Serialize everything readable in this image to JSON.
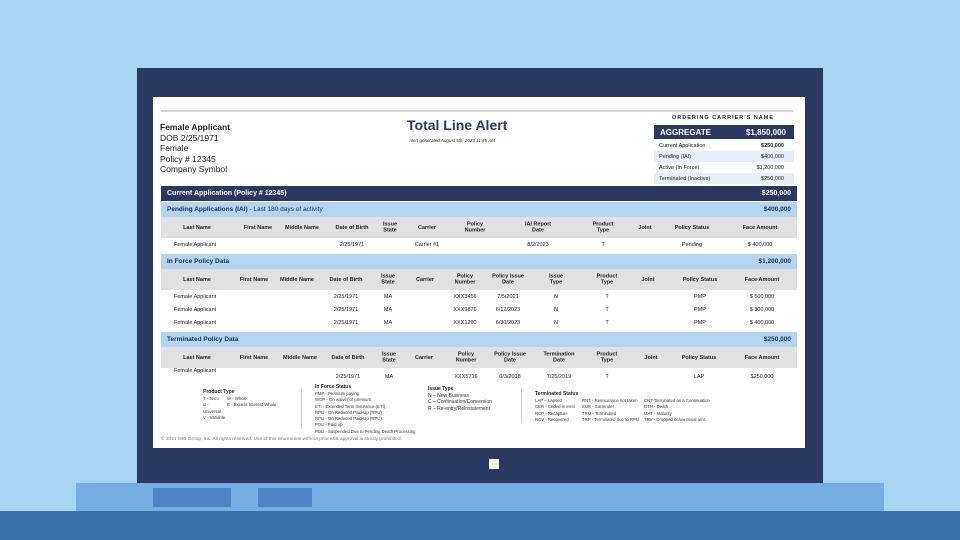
{
  "applicant": {
    "name": "Female Applicant",
    "dob": "DOB 2/25/1971",
    "gender": "Female",
    "policy": "Policy # 12345",
    "company": "Company Symbol"
  },
  "header": {
    "title": "Total Line Alert",
    "generated": "Alert generated August 5th, 2023 11:45 AM"
  },
  "carrier_box": {
    "label": "ORDERING CARRIER'S NAME",
    "aggregate_label": "AGGREGATE",
    "aggregate_value": "$1,850,000",
    "rows": [
      {
        "label": "Current Application",
        "value": "$250,000"
      },
      {
        "label": "Pending (IAI)",
        "value": "$400,000"
      },
      {
        "label": "Active (In Force)",
        "value": "$1,200,000"
      },
      {
        "label": "Terminated (Inactive)",
        "value": "$250,000"
      }
    ]
  },
  "current": {
    "label": "Current Application (Policy # 12345)",
    "value": "$250,000"
  },
  "pending": {
    "label": "Pending Applications (IAI)",
    "sublabel": " - Last 180 days of activity",
    "value": "$400,000",
    "columns": [
      "Last Name",
      "First Name",
      "Middle Name",
      "Date of Birth",
      "Issue\nState",
      "Carrier",
      "Policy\nNumber",
      "IAI Report\nDate",
      "Product\nType",
      "Joint",
      "Policy Status",
      "Face Amount"
    ],
    "rows": [
      [
        "Female Applicant",
        "",
        "",
        "2/25/1971",
        "",
        "Carrier #1",
        "",
        "8/2/2023",
        "T",
        "",
        "Pending",
        "$ 400,000"
      ]
    ]
  },
  "inforce": {
    "label": "In Force Policy Data",
    "value": "$1,200,000",
    "columns": [
      "Last Name",
      "First Name",
      "Middle Name",
      "Date of Birth",
      "Issue\nState",
      "Carrier",
      "Policy\nNumber",
      "Policy Issue\nDate",
      "Issue\nType",
      "Product\nType",
      "Joint",
      "Policy Status",
      "Face Amount"
    ],
    "rows": [
      [
        "Female Applicant",
        "",
        "",
        "2/25/1971",
        "MA",
        "",
        "XXX3456",
        "7/5/2021",
        "N",
        "T",
        "",
        "PMP",
        "$ 500,000"
      ],
      [
        "Female Applicant",
        "",
        "",
        "2/25/1971",
        "MA",
        "",
        "XXX9876",
        "6/12/2023",
        "N",
        "T",
        "",
        "PMP",
        "$ 300,000"
      ],
      [
        "Female Applicant",
        "",
        "",
        "2/25/1971",
        "MA",
        "",
        "XXX1290",
        "6/30/2023",
        "N",
        "T",
        "",
        "PMP",
        "$ 400,000"
      ]
    ]
  },
  "terminated": {
    "label": "Terminated Policy Data",
    "value": "$250,000",
    "columns": [
      "Last Name",
      "First Name",
      "Middle Name",
      "Date of Birth",
      "Issue\nState",
      "Carrier",
      "Policy\nNumber",
      "Policy Issue\nDate",
      "Termination\nDate",
      "Product\nType",
      "Joint",
      "Policy Status",
      "Face Amount"
    ],
    "rows": [
      [
        "Female Applicant",
        "",
        "",
        "2/25/1971",
        "MA",
        "",
        "XXX5716",
        "6/3/2018",
        "7/25/2019",
        "T",
        "",
        "LAP",
        "$250,000"
      ]
    ]
  },
  "legend": {
    "product_type": {
      "title": "Product Type",
      "items": [
        "T - Term",
        "W - Whole",
        "U - Universal",
        "E - Excess Interest Whole",
        "V - Variable"
      ]
    },
    "inforce_status": {
      "title": "In Force Status",
      "items": [
        "PMP - Premium paying",
        "WOP - On waiver of premium",
        "ETI - Extended Term Insurance (ETI)",
        "RPU - On Reduced Paid-Up (RPU)",
        "RPU - On Reduced Paid-Up (RPU)",
        "PDU - Paid up",
        "PDU - Suspended Due to Pending Death Processing"
      ]
    },
    "issue_type": {
      "title": "Issue Type",
      "items": [
        "N – New Business",
        "C – Continuation/Conversion",
        "R – Re-entry/Reinstatement"
      ]
    },
    "terminated_status": {
      "title": "Terminated Status",
      "items": [
        "LAP – Lapsed",
        "CER - Ceded in error",
        "RCP - Recapture",
        "RCV - Recovered",
        "RNT - Reinsurance not taken",
        "SUR - Surrender",
        "TRM - Terminated",
        "TRP - Terminated due to RPU",
        "CNT-Terminated as a Continuation",
        "DTH - Death",
        "MAT - Maturity",
        "TRV - Dropped below trivial amt"
      ]
    }
  },
  "copyright": "© 2021 MIB Group, Inc. All rights reserved. Use of this information without prior MIB approval is strictly prohibited."
}
